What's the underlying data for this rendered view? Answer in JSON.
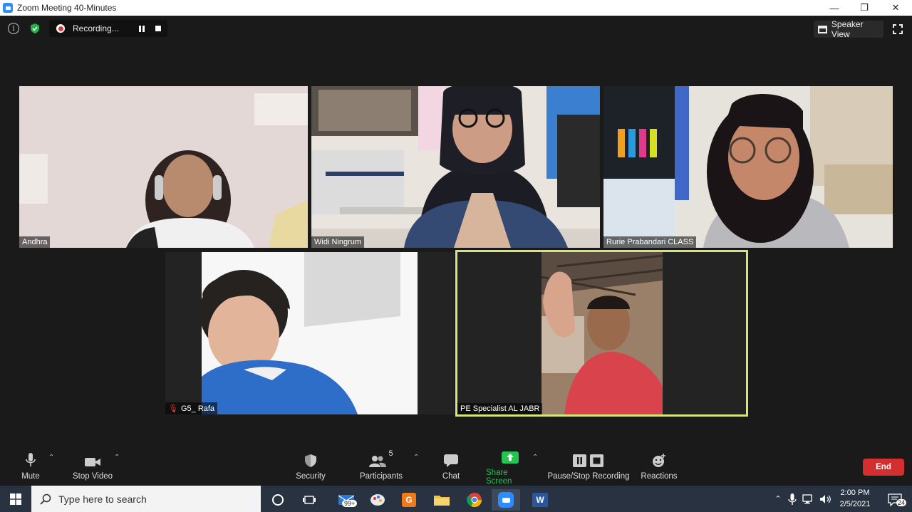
{
  "window": {
    "title": "Zoom Meeting 40-Minutes"
  },
  "recording": {
    "label": "Recording..."
  },
  "view": {
    "label": "Speaker View"
  },
  "participants": [
    {
      "name": "Andhra"
    },
    {
      "name": "Widi Ningrum"
    },
    {
      "name": "Rurie Prabandari CLASS"
    },
    {
      "name": "G5_ Rafa"
    },
    {
      "name": "PE Specialist AL JABR"
    }
  ],
  "toolbar": {
    "mute": "Mute",
    "stop_video": "Stop Video",
    "security": "Security",
    "participants": "Participants",
    "participants_count": "5",
    "chat": "Chat",
    "share_screen": "Share Screen",
    "pause_stop_recording": "Pause/Stop Recording",
    "reactions": "Reactions",
    "end": "End"
  },
  "taskbar": {
    "search_placeholder": "Type here to search",
    "mail_badge": "99+",
    "time": "2:00 PM",
    "date": "2/5/2021",
    "notifications": "24"
  },
  "colors": {
    "accent": "#2d8cff",
    "share_green": "#1fbf4f",
    "end_red": "#d32f2f",
    "active_speaker": "#d4e67a"
  }
}
